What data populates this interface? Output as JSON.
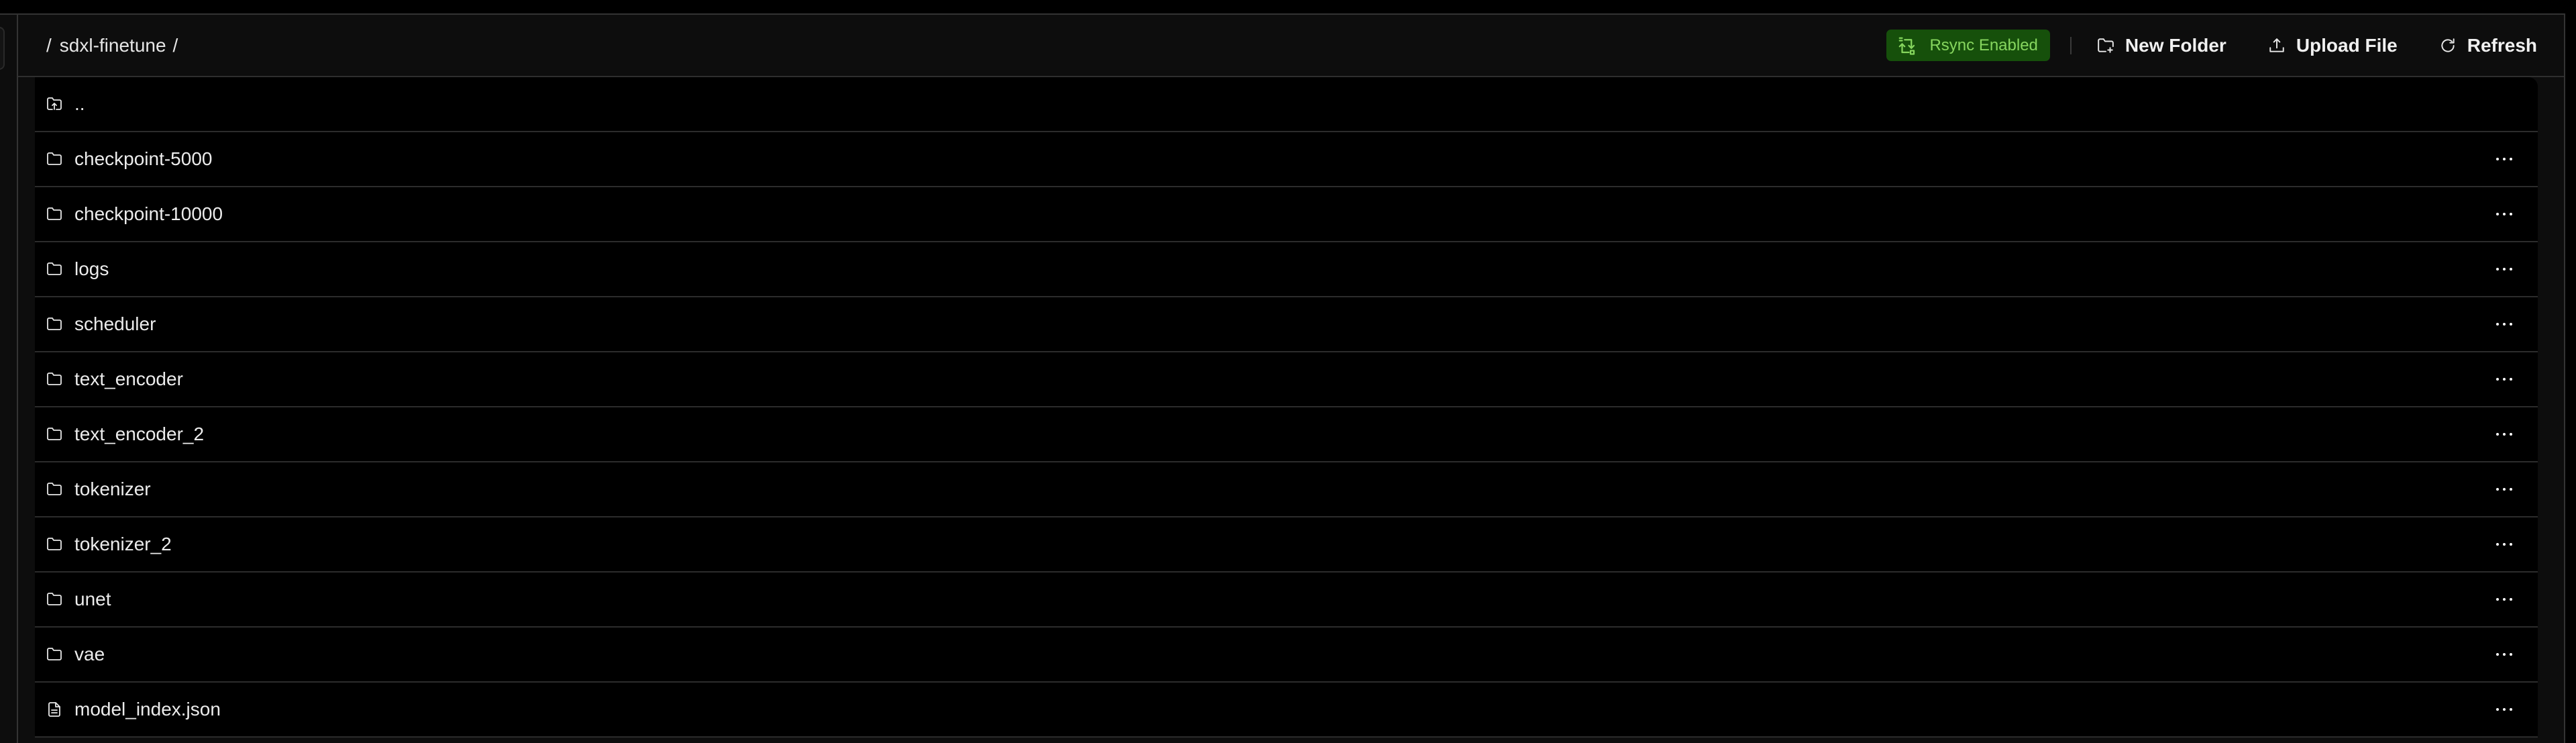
{
  "breadcrumb": {
    "root": "/",
    "current": "sdxl-finetune",
    "trailing": "/"
  },
  "toolbar": {
    "rsync_badge": {
      "label": "Rsync Enabled",
      "icon": "rsync-icon",
      "bg": "#16500b",
      "fg": "#86d65e"
    },
    "new_folder": {
      "label": "New Folder",
      "icon": "folder-plus-icon"
    },
    "upload_file": {
      "label": "Upload File",
      "icon": "upload-icon"
    },
    "refresh": {
      "label": "Refresh",
      "icon": "refresh-icon"
    }
  },
  "files": [
    {
      "name": "..",
      "type": "parent",
      "icon": "folder-up-icon",
      "has_menu": false
    },
    {
      "name": "checkpoint-5000",
      "type": "folder",
      "icon": "folder-icon",
      "has_menu": true
    },
    {
      "name": "checkpoint-10000",
      "type": "folder",
      "icon": "folder-icon",
      "has_menu": true
    },
    {
      "name": "logs",
      "type": "folder",
      "icon": "folder-icon",
      "has_menu": true
    },
    {
      "name": "scheduler",
      "type": "folder",
      "icon": "folder-icon",
      "has_menu": true
    },
    {
      "name": "text_encoder",
      "type": "folder",
      "icon": "folder-icon",
      "has_menu": true
    },
    {
      "name": "text_encoder_2",
      "type": "folder",
      "icon": "folder-icon",
      "has_menu": true
    },
    {
      "name": "tokenizer",
      "type": "folder",
      "icon": "folder-icon",
      "has_menu": true
    },
    {
      "name": "tokenizer_2",
      "type": "folder",
      "icon": "folder-icon",
      "has_menu": true
    },
    {
      "name": "unet",
      "type": "folder",
      "icon": "folder-icon",
      "has_menu": true
    },
    {
      "name": "vae",
      "type": "folder",
      "icon": "folder-icon",
      "has_menu": true
    },
    {
      "name": "model_index.json",
      "type": "file",
      "icon": "file-text-icon",
      "has_menu": true
    }
  ],
  "row_menu": {
    "icon": "more-horizontal-icon",
    "label": "More options"
  }
}
